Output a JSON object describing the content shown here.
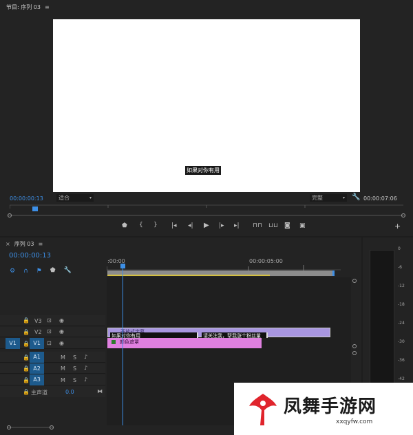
{
  "program_monitor": {
    "title": "节目: 序列 03",
    "menu_icon": "≡",
    "caption": "如果对你有用",
    "timecode_current": "00:00:00:13",
    "timecode_duration": "00:00:07:06",
    "zoom_value": "适合",
    "quality_value": "完整",
    "colors": {
      "accent": "#3d8fe6",
      "video_bg": "#ffffff",
      "caption_bg": "#1a1a1a"
    }
  },
  "sequence_panel": {
    "close_icon": "×",
    "tab_label": "序列 03",
    "menu_icon": "≡",
    "timecode": "00:00:00:13",
    "ruler_start": ":00:00",
    "ruler_mark": "00:00:05:00",
    "video_tracks": [
      {
        "source": "",
        "name": "V3"
      },
      {
        "source": "",
        "name": "V2"
      },
      {
        "source": "V1",
        "name": "V1"
      }
    ],
    "audio_tracks": [
      {
        "name": "A1",
        "m": "M",
        "s": "S"
      },
      {
        "name": "A2",
        "m": "M",
        "s": "S"
      },
      {
        "name": "A3",
        "m": "M",
        "s": "S"
      }
    ],
    "master": {
      "label": "主声道",
      "value": "0.0"
    },
    "clips": {
      "v3_label": "开放式字幕",
      "v3_caption_1": "如果对你有用",
      "v3_caption_2": "请关注我，帮我涨个粉丝量",
      "v2_label": "颜色遮罩"
    },
    "clip_colors": {
      "caption_clip": "#a896e0",
      "matte_clip": "#e080e0",
      "work_area": "#d4c042"
    }
  },
  "audio_meter": {
    "scale": [
      "0",
      "-6",
      "-12",
      "-18",
      "-24",
      "-30",
      "-36",
      "-42"
    ]
  },
  "watermark": {
    "brand": "凤舞手游网",
    "url": "xxqyfw.com"
  }
}
